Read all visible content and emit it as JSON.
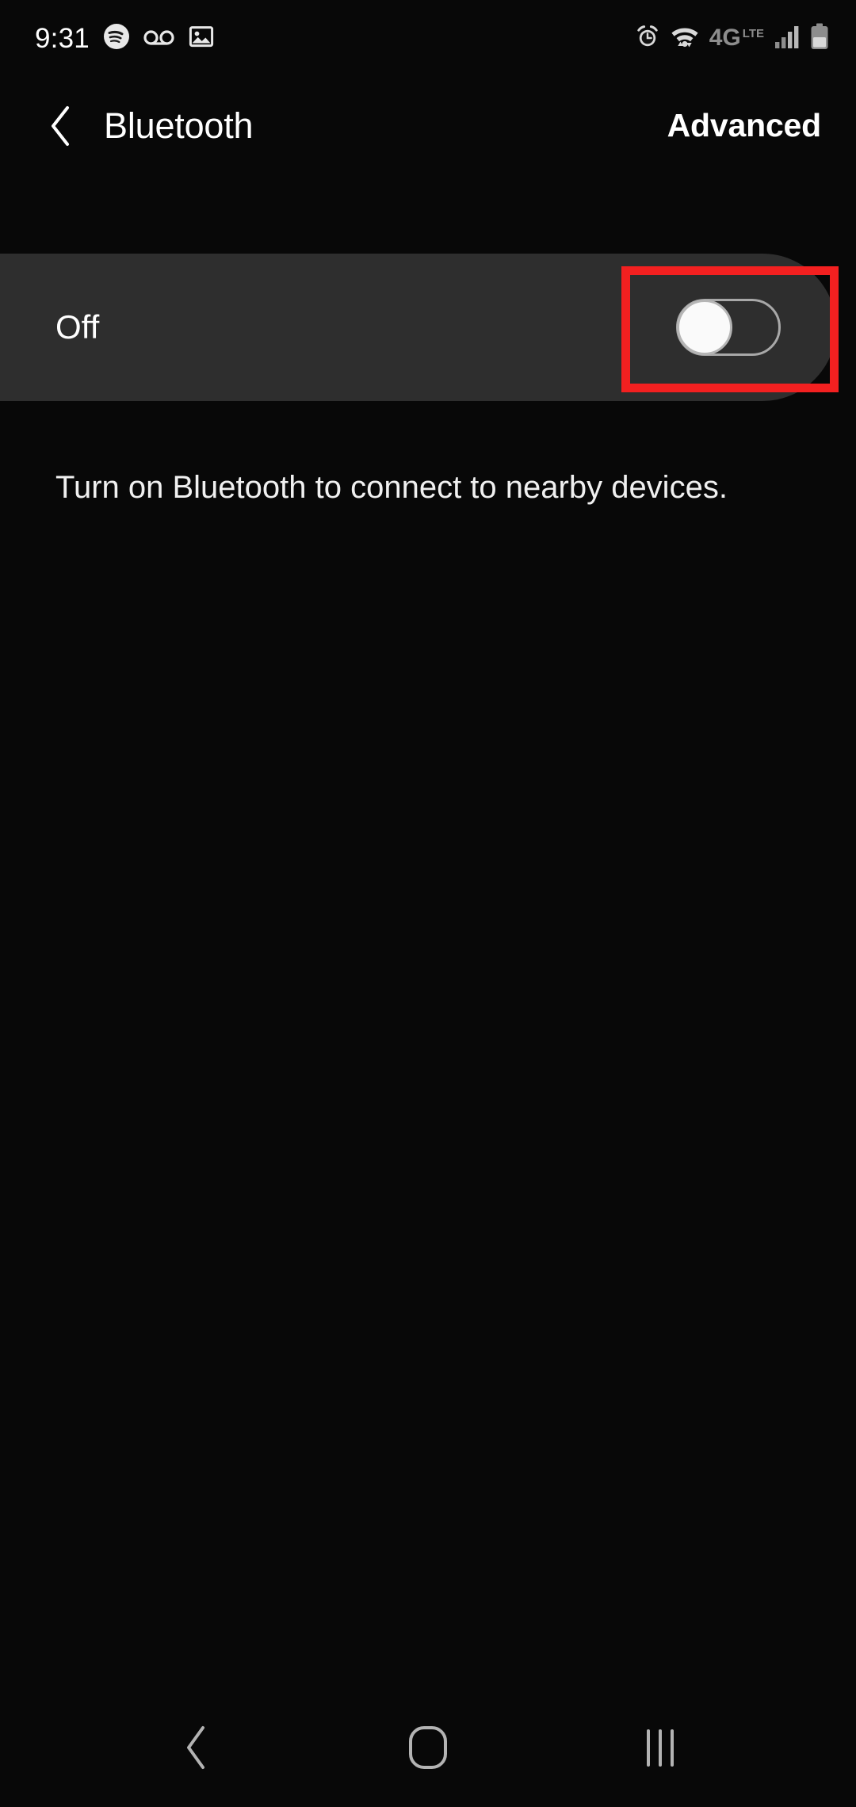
{
  "status_bar": {
    "time": "9:31",
    "left_icons": [
      {
        "name": "spotify-icon",
        "label": "Spotify"
      },
      {
        "name": "voicemail-icon",
        "label": "Voicemail"
      },
      {
        "name": "gallery-image-icon",
        "label": "Screenshot saved"
      }
    ],
    "right_icons": [
      {
        "name": "alarm-clock-icon",
        "label": "Alarm set"
      },
      {
        "name": "wifi-icon",
        "label": "Wi-Fi connected"
      },
      {
        "name": "network-type-icon",
        "label": "4G LTE"
      },
      {
        "name": "signal-bars-icon",
        "label": "Signal strength"
      },
      {
        "name": "battery-icon",
        "label": "Battery"
      }
    ],
    "network_type": "4G",
    "network_type_suffix": "LTE"
  },
  "header": {
    "back_icon": "chevron-left-icon",
    "title": "Bluetooth",
    "action_label": "Advanced"
  },
  "toggle_card": {
    "label": "Off",
    "state": "off",
    "switch_name": "bluetooth-toggle"
  },
  "annotation": {
    "color": "#f32020",
    "target": "bluetooth-toggle"
  },
  "description": "Turn on Bluetooth to connect to nearby devices.",
  "nav_bar": {
    "back_label": "Back",
    "home_label": "Home",
    "recents_label": "Recents"
  },
  "colors": {
    "background": "#080808",
    "card": "#2e2e2e",
    "text_primary": "#ffffff",
    "text_secondary": "#f0f0f0",
    "icon_grey": "#b3b3b3",
    "highlight": "#f32020"
  }
}
